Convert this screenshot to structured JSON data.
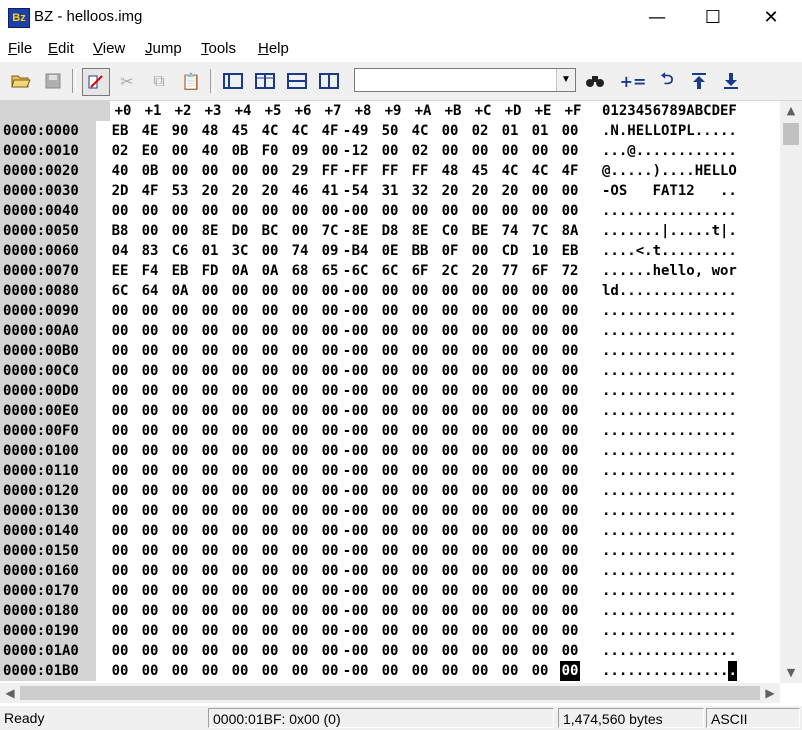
{
  "window": {
    "icon_text": "Bz",
    "title": "BZ - helloos.img",
    "minimize": "—",
    "maximize": "☐",
    "close": "✕"
  },
  "menu": [
    {
      "label": "File",
      "ul": "F",
      "rest": "ile"
    },
    {
      "label": "Edit",
      "ul": "E",
      "rest": "dit"
    },
    {
      "label": "View",
      "ul": "V",
      "rest": "iew"
    },
    {
      "label": "Jump",
      "ul": "J",
      "rest": "ump"
    },
    {
      "label": "Tools",
      "ul": "T",
      "rest": "ools"
    },
    {
      "label": "Help",
      "ul": "H",
      "rest": "elp"
    }
  ],
  "toolbar": {
    "buttons": [
      "open-icon",
      "save-icon",
      "compare-icon",
      "cut-icon",
      "copy-icon",
      "paste-icon",
      "layout-1-icon",
      "layout-2-icon",
      "layout-3-icon",
      "layout-4-icon",
      "find-icon",
      "fill-icon",
      "undo-icon",
      "jump-up-icon",
      "jump-down-icon"
    ],
    "search_value": ""
  },
  "hex_view": {
    "header_offsets": [
      "+0",
      "+1",
      "+2",
      "+3",
      "+4",
      "+5",
      "+6",
      "+7",
      "+8",
      "+9",
      "+A",
      "+B",
      "+C",
      "+D",
      "+E",
      "+F"
    ],
    "header_ascii": "0123456789ABCDEF",
    "rows": [
      {
        "addr": "0000:0000",
        "bytes": [
          "EB",
          "4E",
          "90",
          "48",
          "45",
          "4C",
          "4C",
          "4F",
          "49",
          "50",
          "4C",
          "00",
          "02",
          "01",
          "01",
          "00"
        ],
        "ascii": ".N.HELLOIPL....."
      },
      {
        "addr": "0000:0010",
        "bytes": [
          "02",
          "E0",
          "00",
          "40",
          "0B",
          "F0",
          "09",
          "00",
          "12",
          "00",
          "02",
          "00",
          "00",
          "00",
          "00",
          "00"
        ],
        "ascii": "...@............"
      },
      {
        "addr": "0000:0020",
        "bytes": [
          "40",
          "0B",
          "00",
          "00",
          "00",
          "00",
          "29",
          "FF",
          "FF",
          "FF",
          "FF",
          "48",
          "45",
          "4C",
          "4C",
          "4F"
        ],
        "ascii": "@.....)....HELLO"
      },
      {
        "addr": "0000:0030",
        "bytes": [
          "2D",
          "4F",
          "53",
          "20",
          "20",
          "20",
          "46",
          "41",
          "54",
          "31",
          "32",
          "20",
          "20",
          "20",
          "00",
          "00"
        ],
        "ascii": "-OS   FAT12   .."
      },
      {
        "addr": "0000:0040",
        "bytes": [
          "00",
          "00",
          "00",
          "00",
          "00",
          "00",
          "00",
          "00",
          "00",
          "00",
          "00",
          "00",
          "00",
          "00",
          "00",
          "00"
        ],
        "ascii": "................"
      },
      {
        "addr": "0000:0050",
        "bytes": [
          "B8",
          "00",
          "00",
          "8E",
          "D0",
          "BC",
          "00",
          "7C",
          "8E",
          "D8",
          "8E",
          "C0",
          "BE",
          "74",
          "7C",
          "8A"
        ],
        "ascii": ".......|.....t|."
      },
      {
        "addr": "0000:0060",
        "bytes": [
          "04",
          "83",
          "C6",
          "01",
          "3C",
          "00",
          "74",
          "09",
          "B4",
          "0E",
          "BB",
          "0F",
          "00",
          "CD",
          "10",
          "EB"
        ],
        "ascii": "....<.t........."
      },
      {
        "addr": "0000:0070",
        "bytes": [
          "EE",
          "F4",
          "EB",
          "FD",
          "0A",
          "0A",
          "68",
          "65",
          "6C",
          "6C",
          "6F",
          "2C",
          "20",
          "77",
          "6F",
          "72"
        ],
        "ascii": "......hello, wor"
      },
      {
        "addr": "0000:0080",
        "bytes": [
          "6C",
          "64",
          "0A",
          "00",
          "00",
          "00",
          "00",
          "00",
          "00",
          "00",
          "00",
          "00",
          "00",
          "00",
          "00",
          "00"
        ],
        "ascii": "ld.............."
      },
      {
        "addr": "0000:0090",
        "bytes": [
          "00",
          "00",
          "00",
          "00",
          "00",
          "00",
          "00",
          "00",
          "00",
          "00",
          "00",
          "00",
          "00",
          "00",
          "00",
          "00"
        ],
        "ascii": "................"
      },
      {
        "addr": "0000:00A0",
        "bytes": [
          "00",
          "00",
          "00",
          "00",
          "00",
          "00",
          "00",
          "00",
          "00",
          "00",
          "00",
          "00",
          "00",
          "00",
          "00",
          "00"
        ],
        "ascii": "................"
      },
      {
        "addr": "0000:00B0",
        "bytes": [
          "00",
          "00",
          "00",
          "00",
          "00",
          "00",
          "00",
          "00",
          "00",
          "00",
          "00",
          "00",
          "00",
          "00",
          "00",
          "00"
        ],
        "ascii": "................"
      },
      {
        "addr": "0000:00C0",
        "bytes": [
          "00",
          "00",
          "00",
          "00",
          "00",
          "00",
          "00",
          "00",
          "00",
          "00",
          "00",
          "00",
          "00",
          "00",
          "00",
          "00"
        ],
        "ascii": "................"
      },
      {
        "addr": "0000:00D0",
        "bytes": [
          "00",
          "00",
          "00",
          "00",
          "00",
          "00",
          "00",
          "00",
          "00",
          "00",
          "00",
          "00",
          "00",
          "00",
          "00",
          "00"
        ],
        "ascii": "................"
      },
      {
        "addr": "0000:00E0",
        "bytes": [
          "00",
          "00",
          "00",
          "00",
          "00",
          "00",
          "00",
          "00",
          "00",
          "00",
          "00",
          "00",
          "00",
          "00",
          "00",
          "00"
        ],
        "ascii": "................"
      },
      {
        "addr": "0000:00F0",
        "bytes": [
          "00",
          "00",
          "00",
          "00",
          "00",
          "00",
          "00",
          "00",
          "00",
          "00",
          "00",
          "00",
          "00",
          "00",
          "00",
          "00"
        ],
        "ascii": "................"
      },
      {
        "addr": "0000:0100",
        "bytes": [
          "00",
          "00",
          "00",
          "00",
          "00",
          "00",
          "00",
          "00",
          "00",
          "00",
          "00",
          "00",
          "00",
          "00",
          "00",
          "00"
        ],
        "ascii": "................"
      },
      {
        "addr": "0000:0110",
        "bytes": [
          "00",
          "00",
          "00",
          "00",
          "00",
          "00",
          "00",
          "00",
          "00",
          "00",
          "00",
          "00",
          "00",
          "00",
          "00",
          "00"
        ],
        "ascii": "................"
      },
      {
        "addr": "0000:0120",
        "bytes": [
          "00",
          "00",
          "00",
          "00",
          "00",
          "00",
          "00",
          "00",
          "00",
          "00",
          "00",
          "00",
          "00",
          "00",
          "00",
          "00"
        ],
        "ascii": "................"
      },
      {
        "addr": "0000:0130",
        "bytes": [
          "00",
          "00",
          "00",
          "00",
          "00",
          "00",
          "00",
          "00",
          "00",
          "00",
          "00",
          "00",
          "00",
          "00",
          "00",
          "00"
        ],
        "ascii": "................"
      },
      {
        "addr": "0000:0140",
        "bytes": [
          "00",
          "00",
          "00",
          "00",
          "00",
          "00",
          "00",
          "00",
          "00",
          "00",
          "00",
          "00",
          "00",
          "00",
          "00",
          "00"
        ],
        "ascii": "................"
      },
      {
        "addr": "0000:0150",
        "bytes": [
          "00",
          "00",
          "00",
          "00",
          "00",
          "00",
          "00",
          "00",
          "00",
          "00",
          "00",
          "00",
          "00",
          "00",
          "00",
          "00"
        ],
        "ascii": "................"
      },
      {
        "addr": "0000:0160",
        "bytes": [
          "00",
          "00",
          "00",
          "00",
          "00",
          "00",
          "00",
          "00",
          "00",
          "00",
          "00",
          "00",
          "00",
          "00",
          "00",
          "00"
        ],
        "ascii": "................"
      },
      {
        "addr": "0000:0170",
        "bytes": [
          "00",
          "00",
          "00",
          "00",
          "00",
          "00",
          "00",
          "00",
          "00",
          "00",
          "00",
          "00",
          "00",
          "00",
          "00",
          "00"
        ],
        "ascii": "................"
      },
      {
        "addr": "0000:0180",
        "bytes": [
          "00",
          "00",
          "00",
          "00",
          "00",
          "00",
          "00",
          "00",
          "00",
          "00",
          "00",
          "00",
          "00",
          "00",
          "00",
          "00"
        ],
        "ascii": "................"
      },
      {
        "addr": "0000:0190",
        "bytes": [
          "00",
          "00",
          "00",
          "00",
          "00",
          "00",
          "00",
          "00",
          "00",
          "00",
          "00",
          "00",
          "00",
          "00",
          "00",
          "00"
        ],
        "ascii": "................"
      },
      {
        "addr": "0000:01A0",
        "bytes": [
          "00",
          "00",
          "00",
          "00",
          "00",
          "00",
          "00",
          "00",
          "00",
          "00",
          "00",
          "00",
          "00",
          "00",
          "00",
          "00"
        ],
        "ascii": "................"
      },
      {
        "addr": "0000:01B0",
        "bytes": [
          "00",
          "00",
          "00",
          "00",
          "00",
          "00",
          "00",
          "00",
          "00",
          "00",
          "00",
          "00",
          "00",
          "00",
          "00",
          "00"
        ],
        "ascii": "................"
      }
    ],
    "cursor": {
      "row": 27,
      "col": 15
    }
  },
  "status": {
    "ready": "Ready",
    "position": "0000:01BF: 0x00 (0)",
    "size": "1,474,560 bytes",
    "encoding": "ASCII"
  },
  "colors": {
    "address_bg": "#d4d4d4",
    "toolbar_icon": "#1a3a8a"
  }
}
